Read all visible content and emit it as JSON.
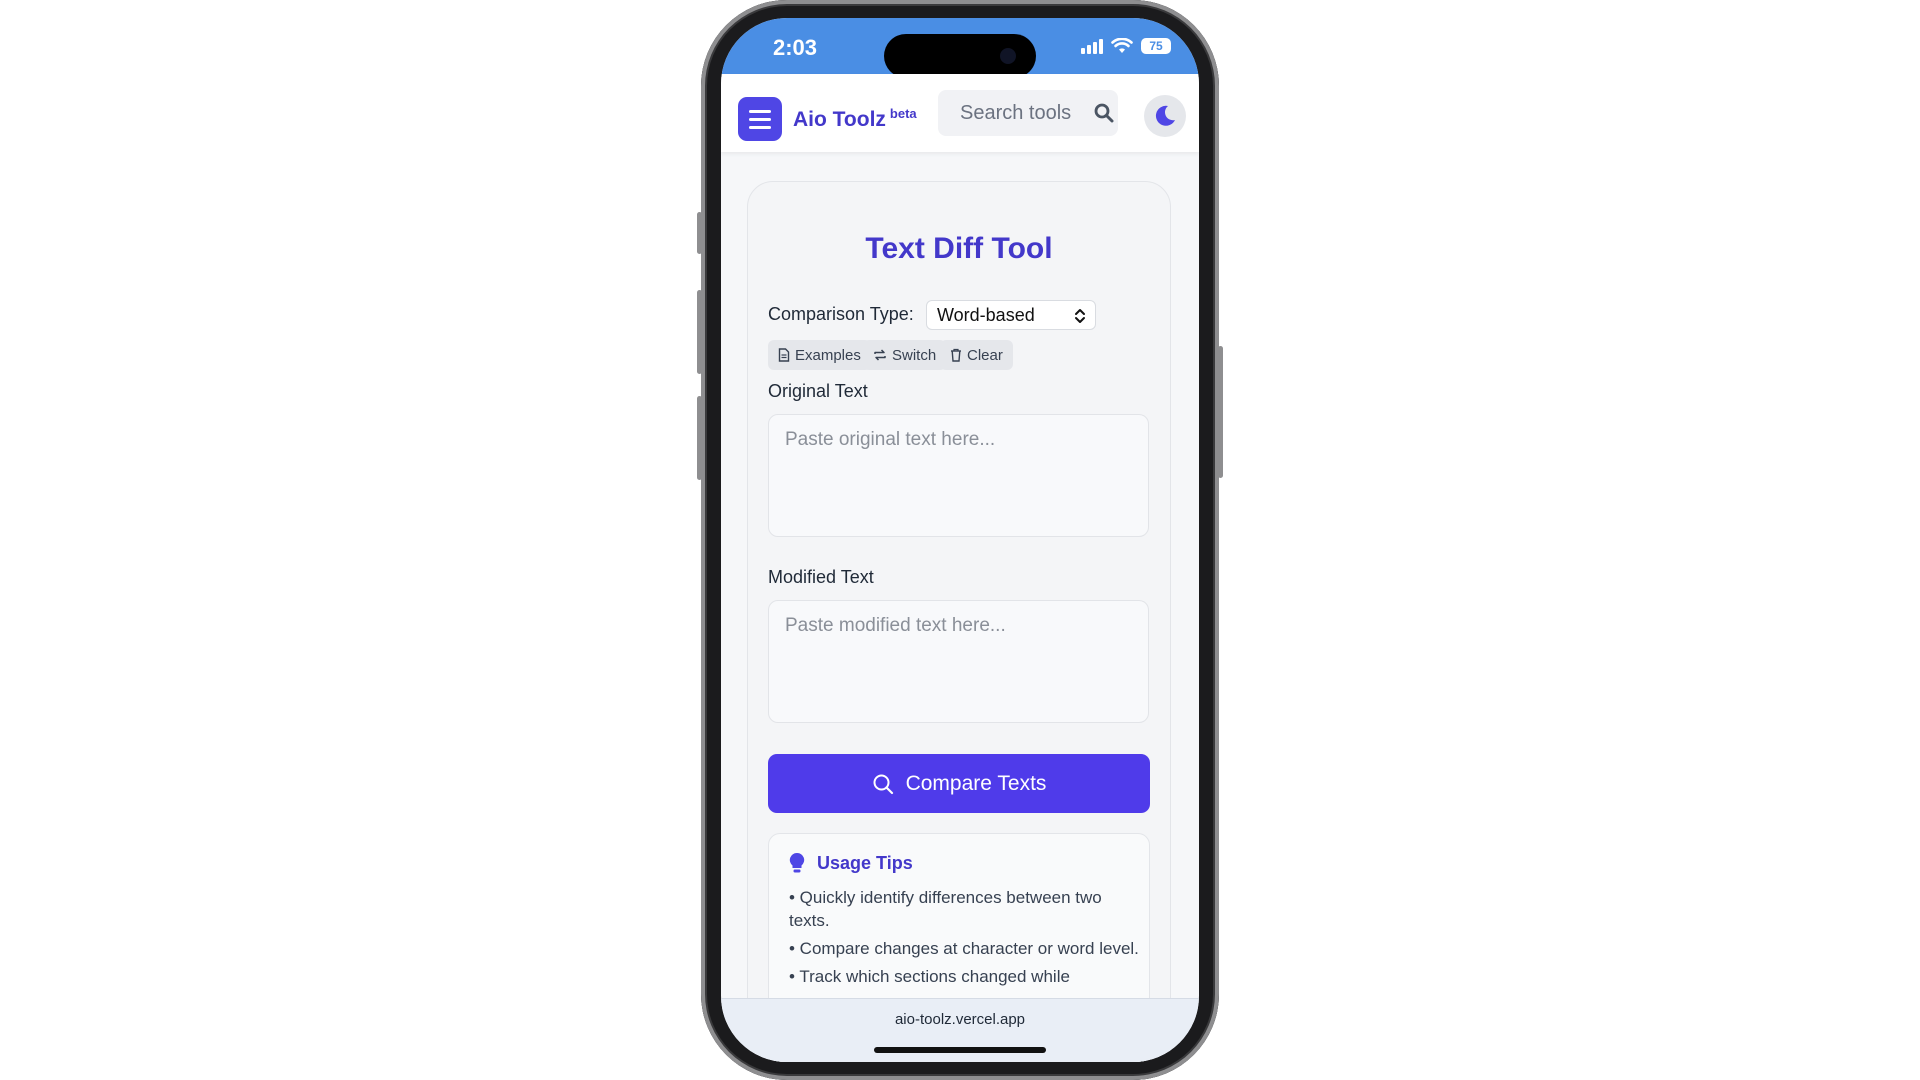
{
  "status_bar": {
    "time": "2:03",
    "battery": "75"
  },
  "header": {
    "brand": "Aio Toolz",
    "brand_badge": "beta",
    "search_placeholder": "Search tools",
    "accent_color": "#4f46e5"
  },
  "tool": {
    "title": "Text Diff Tool",
    "comparison_label": "Comparison Type:",
    "comparison_value": "Word-based",
    "actions": [
      "Examples",
      "Switch",
      "Clear"
    ],
    "original_label": "Original Text",
    "original_placeholder": "Paste original text here...",
    "modified_label": "Modified Text",
    "modified_placeholder": "Paste modified text here...",
    "compare_button": "Compare Texts"
  },
  "tips": {
    "title": "Usage Tips",
    "items": [
      "• Quickly identify differences between two texts.",
      "• Compare changes at character or word level.",
      "• Track which sections changed while"
    ]
  },
  "browser": {
    "url": "aio-toolz.vercel.app"
  }
}
